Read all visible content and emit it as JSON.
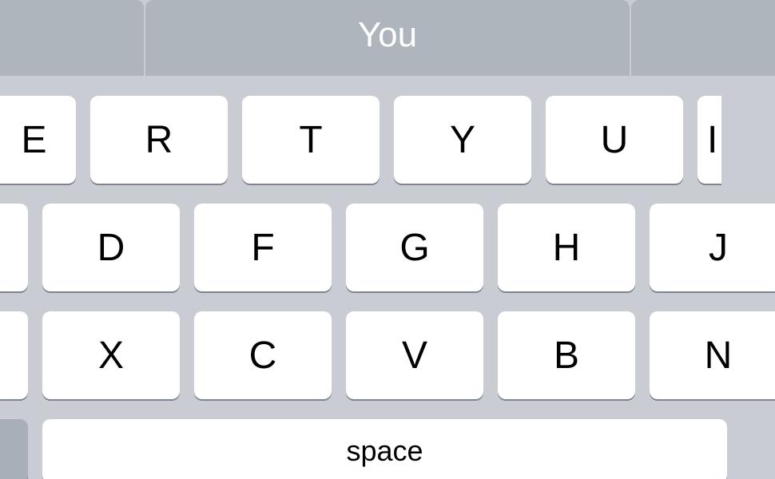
{
  "suggestions": {
    "left": "",
    "center": "You",
    "right": ""
  },
  "rows": {
    "r1": {
      "k0": "E",
      "k1": "R",
      "k2": "T",
      "k3": "Y",
      "k4": "U",
      "k5": "I"
    },
    "r2": {
      "k0": "",
      "k1": "D",
      "k2": "F",
      "k3": "G",
      "k4": "H",
      "k5": "J",
      "k6": ""
    },
    "r3": {
      "k0": "",
      "k1": "X",
      "k2": "C",
      "k3": "V",
      "k4": "B",
      "k5": "N"
    }
  },
  "space_label": "space"
}
